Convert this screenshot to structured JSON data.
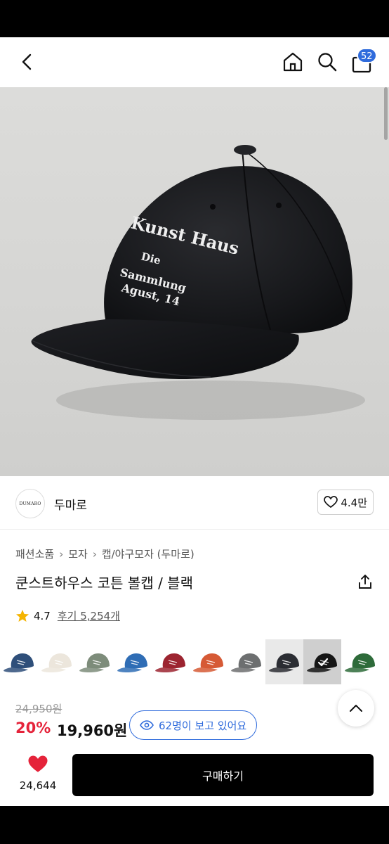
{
  "header": {
    "back_icon": "chevron-left-icon",
    "home_icon": "home-icon",
    "search_icon": "search-icon",
    "cart_icon": "shopping-bag-icon",
    "cart_count": "52"
  },
  "hero": {
    "embroidery": [
      "Kunst Haus",
      "Die",
      "Sammlung",
      "Agust, 14"
    ]
  },
  "brand": {
    "logo_text": "DUMARO",
    "name": "두마로",
    "like_count": "4.4만"
  },
  "product": {
    "breadcrumbs": [
      "패션소품",
      "모자",
      "캡/야구모자 (두마로)"
    ],
    "title": "쿤스트하우스 코튼 볼캡 / 블랙",
    "rating": "4.7",
    "review_label": "후기 5,254개"
  },
  "swatches": [
    {
      "color": "#2f4f7a"
    },
    {
      "color": "#ece6dc"
    },
    {
      "color": "#7d8c7a"
    },
    {
      "color": "#2f6db5"
    },
    {
      "color": "#9c2430"
    },
    {
      "color": "#d65a35"
    },
    {
      "color": "#6d6f70"
    },
    {
      "color": "#2b2d33"
    },
    {
      "color": "#151515",
      "selected": true
    },
    {
      "color": "#2e6b3a"
    }
  ],
  "price": {
    "original": "24,950원",
    "discount": "20%",
    "sale": "19,960원",
    "viewers": "62명이 보고 있어요"
  },
  "purchase": {
    "like_count": "24,644",
    "buy_label": "구매하기"
  },
  "colors": {
    "accent": "#2f6bdc",
    "sale_red": "#e5233a",
    "heart": "#e5233a"
  }
}
